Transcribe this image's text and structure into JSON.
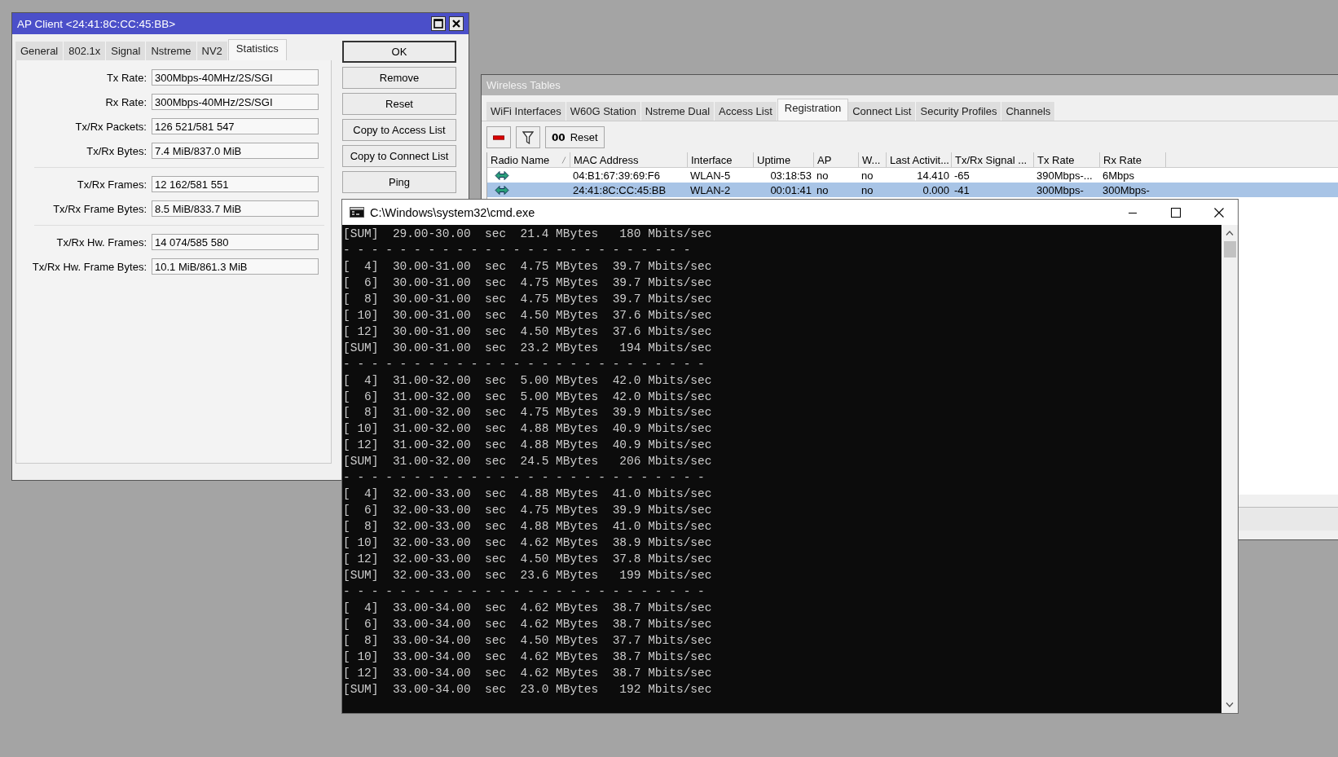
{
  "ap_client": {
    "title": "AP Client <24:41:8C:CC:45:BB>",
    "tabs": [
      {
        "label": "General",
        "selected": false
      },
      {
        "label": "802.1x",
        "selected": false
      },
      {
        "label": "Signal",
        "selected": false
      },
      {
        "label": "Nstreme",
        "selected": false
      },
      {
        "label": "NV2",
        "selected": false
      },
      {
        "label": "Statistics",
        "selected": true
      }
    ],
    "groups": [
      [
        {
          "label": "Tx Rate:",
          "value": "300Mbps-40MHz/2S/SGI"
        },
        {
          "label": "Rx Rate:",
          "value": "300Mbps-40MHz/2S/SGI"
        },
        {
          "label": "Tx/Rx Packets:",
          "value": "126 521/581 547"
        },
        {
          "label": "Tx/Rx Bytes:",
          "value": "7.4 MiB/837.0 MiB"
        }
      ],
      [
        {
          "label": "Tx/Rx Frames:",
          "value": "12 162/581 551"
        },
        {
          "label": "Tx/Rx Frame Bytes:",
          "value": "8.5 MiB/833.7 MiB"
        }
      ],
      [
        {
          "label": "Tx/Rx Hw. Frames:",
          "value": "14 074/585 580"
        },
        {
          "label": "Tx/Rx Hw. Frame Bytes:",
          "value": "10.1 MiB/861.3 MiB"
        }
      ]
    ],
    "buttons": [
      {
        "label": "OK",
        "kind": "default"
      },
      {
        "label": "Remove",
        "kind": "normal"
      },
      {
        "label": "Reset",
        "kind": "normal"
      },
      {
        "label": "Copy to Access List",
        "kind": "normal"
      },
      {
        "label": "Copy to Connect List",
        "kind": "normal"
      },
      {
        "label": "Ping",
        "kind": "normal"
      }
    ]
  },
  "wireless_tables": {
    "title": "Wireless Tables",
    "tabs": [
      {
        "label": "WiFi Interfaces",
        "selected": false
      },
      {
        "label": "W60G Station",
        "selected": false
      },
      {
        "label": "Nstreme Dual",
        "selected": false
      },
      {
        "label": "Access List",
        "selected": false
      },
      {
        "label": "Registration",
        "selected": true
      },
      {
        "label": "Connect List",
        "selected": false
      },
      {
        "label": "Security Profiles",
        "selected": false
      },
      {
        "label": "Channels",
        "selected": false
      }
    ],
    "toolbar": {
      "reset_glyph": "00",
      "reset_label": "Reset"
    },
    "columns": [
      "Radio Name",
      "MAC Address",
      "Interface",
      "Uptime",
      "AP",
      "W...",
      "Last Activit...",
      "Tx/Rx Signal ...",
      "Tx Rate",
      "Rx Rate"
    ],
    "rows": [
      {
        "selected": false,
        "cells": [
          "",
          "04:B1:67:39:69:F6",
          "WLAN-5",
          "03:18:53",
          "no",
          "no",
          "14.410",
          "-65",
          "390Mbps-...",
          "6Mbps"
        ]
      },
      {
        "selected": true,
        "cells": [
          "",
          "24:41:8C:CC:45:BB",
          "WLAN-2",
          "00:01:41",
          "no",
          "no",
          "0.000",
          "-41",
          "300Mbps-",
          "300Mbps-"
        ]
      }
    ]
  },
  "console": {
    "title": "C:\\Windows\\system32\\cmd.exe",
    "lines": [
      "[SUM]  29.00-30.00  sec  21.4 MBytes   180 Mbits/sec",
      "- - - - - - - - - - - - - - - - - - - - - - - - -",
      "[  4]  30.00-31.00  sec  4.75 MBytes  39.7 Mbits/sec",
      "[  6]  30.00-31.00  sec  4.75 MBytes  39.7 Mbits/sec",
      "[  8]  30.00-31.00  sec  4.75 MBytes  39.7 Mbits/sec",
      "[ 10]  30.00-31.00  sec  4.50 MBytes  37.6 Mbits/sec",
      "[ 12]  30.00-31.00  sec  4.50 MBytes  37.6 Mbits/sec",
      "[SUM]  30.00-31.00  sec  23.2 MBytes   194 Mbits/sec",
      "- - - - - - - - - - - - - - - - - - - - - - - - - -",
      "[  4]  31.00-32.00  sec  5.00 MBytes  42.0 Mbits/sec",
      "[  6]  31.00-32.00  sec  5.00 MBytes  42.0 Mbits/sec",
      "[  8]  31.00-32.00  sec  4.75 MBytes  39.9 Mbits/sec",
      "[ 10]  31.00-32.00  sec  4.88 MBytes  40.9 Mbits/sec",
      "[ 12]  31.00-32.00  sec  4.88 MBytes  40.9 Mbits/sec",
      "[SUM]  31.00-32.00  sec  24.5 MBytes   206 Mbits/sec",
      "- - - - - - - - - - - - - - - - - - - - - - - - - -",
      "[  4]  32.00-33.00  sec  4.88 MBytes  41.0 Mbits/sec",
      "[  6]  32.00-33.00  sec  4.75 MBytes  39.9 Mbits/sec",
      "[  8]  32.00-33.00  sec  4.88 MBytes  41.0 Mbits/sec",
      "[ 10]  32.00-33.00  sec  4.62 MBytes  38.9 Mbits/sec",
      "[ 12]  32.00-33.00  sec  4.50 MBytes  37.8 Mbits/sec",
      "[SUM]  32.00-33.00  sec  23.6 MBytes   199 Mbits/sec",
      "- - - - - - - - - - - - - - - - - - - - - - - - - -",
      "[  4]  33.00-34.00  sec  4.62 MBytes  38.7 Mbits/sec",
      "[  6]  33.00-34.00  sec  4.62 MBytes  38.7 Mbits/sec",
      "[  8]  33.00-34.00  sec  4.50 MBytes  37.7 Mbits/sec",
      "[ 10]  33.00-34.00  sec  4.62 MBytes  38.7 Mbits/sec",
      "[ 12]  33.00-34.00  sec  4.62 MBytes  38.7 Mbits/sec",
      "[SUM]  33.00-34.00  sec  23.0 MBytes   192 Mbits/sec"
    ]
  }
}
